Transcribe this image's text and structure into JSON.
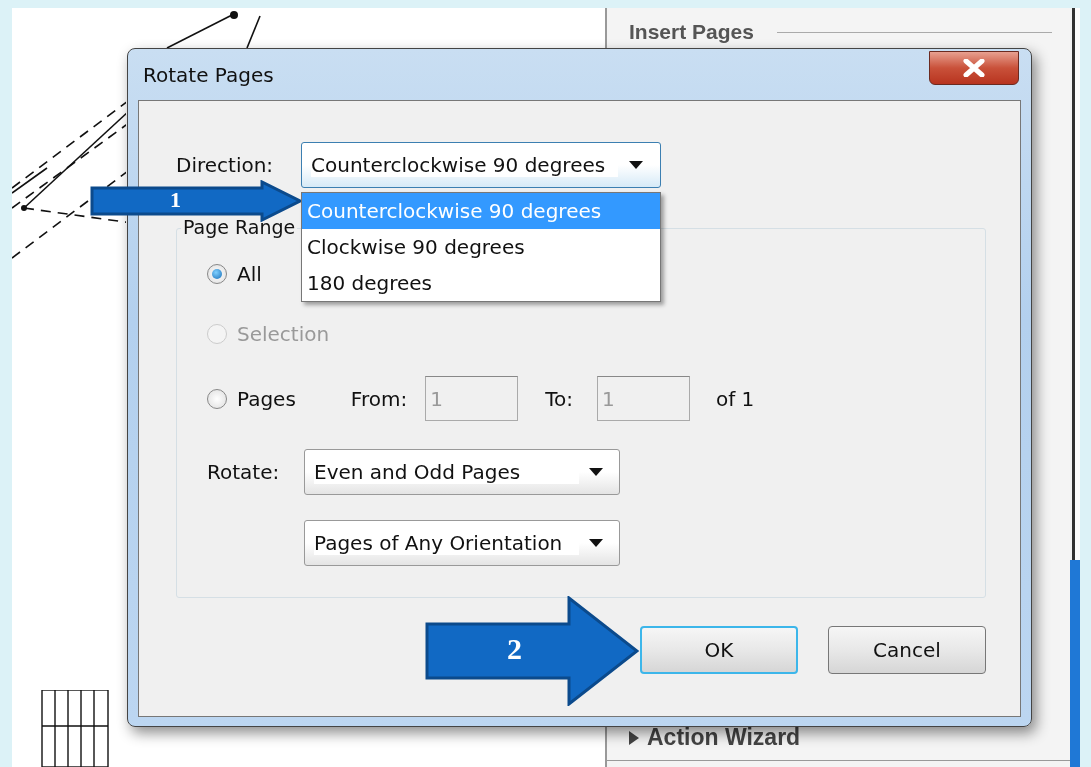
{
  "background": {
    "panel_title": "Insert Pages",
    "panel_section": "Action Wizard"
  },
  "dialog": {
    "title": "Rotate Pages",
    "direction": {
      "label": "Direction:",
      "value": "Counterclockwise 90 degrees",
      "expanded": true,
      "options": [
        {
          "label": "Counterclockwise 90 degrees",
          "selected": true
        },
        {
          "label": "Clockwise 90 degrees",
          "selected": false
        },
        {
          "label": "180 degrees",
          "selected": false
        }
      ]
    },
    "page_range": {
      "label": "Page Range",
      "options": [
        {
          "label": "All",
          "selected": true,
          "disabled": false
        },
        {
          "label": "Selection",
          "selected": false,
          "disabled": true
        },
        {
          "label": "Pages",
          "selected": false,
          "disabled": false
        }
      ],
      "from": {
        "label": "From:",
        "value": "1",
        "disabled": true
      },
      "to": {
        "label": "To:",
        "value": "1",
        "disabled": true
      },
      "of": "of 1"
    },
    "rotate": {
      "label": "Rotate:",
      "parity": "Even and Odd Pages",
      "orientation": "Pages of Any Orientation"
    },
    "buttons": [
      {
        "label": "OK",
        "focused": true
      },
      {
        "label": "Cancel",
        "focused": false
      }
    ]
  },
  "callouts": [
    {
      "number": "1"
    },
    {
      "number": "2"
    }
  ]
}
